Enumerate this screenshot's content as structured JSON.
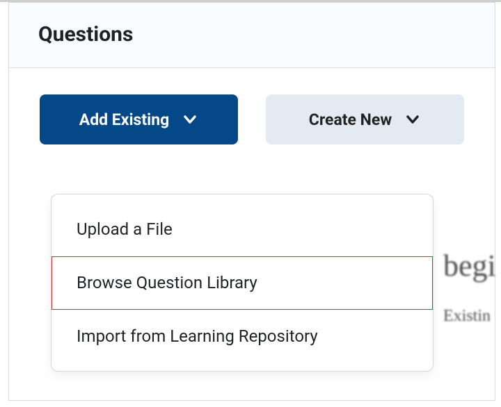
{
  "header": {
    "title": "Questions"
  },
  "toolbar": {
    "add_existing_label": "Add Existing",
    "create_new_label": "Create New"
  },
  "dropdown": {
    "items": [
      {
        "label": "Upload a File",
        "highlight": false
      },
      {
        "label": "Browse Question Library",
        "highlight": true
      },
      {
        "label": "Import from Learning Repository",
        "highlight": false
      }
    ]
  },
  "background": {
    "fragment1": "begi",
    "fragment2": "Existin"
  }
}
